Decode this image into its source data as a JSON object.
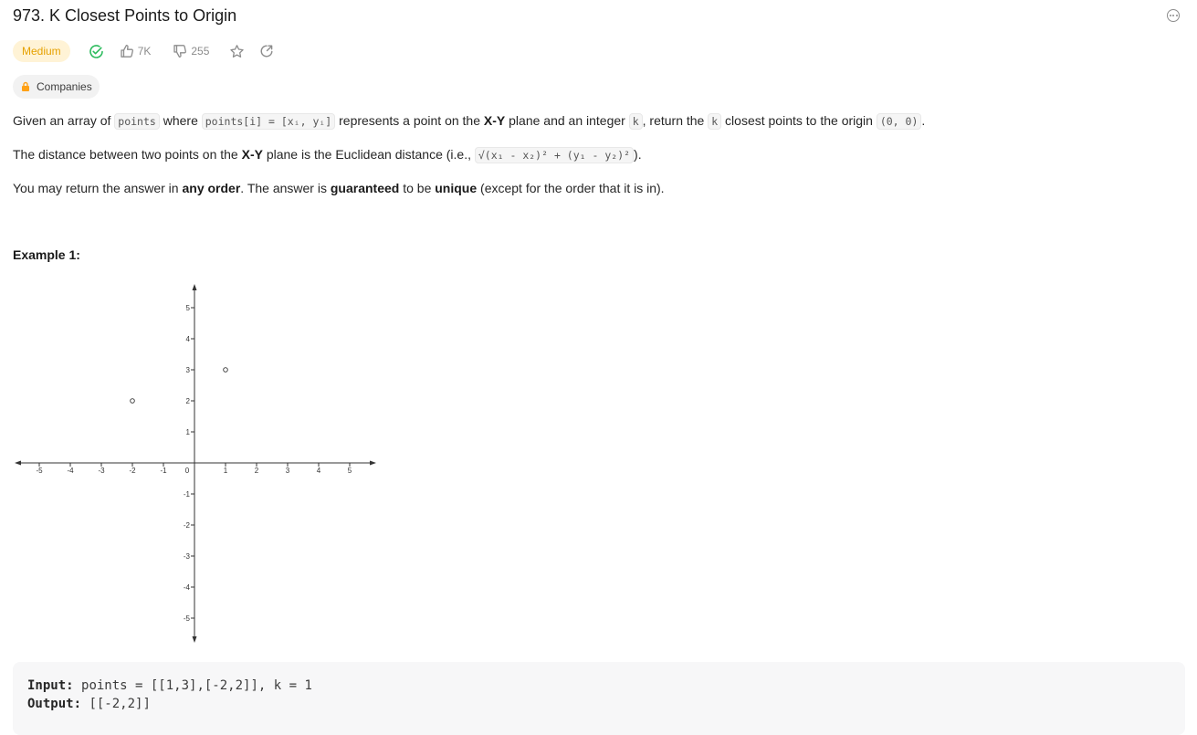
{
  "problem": {
    "title": "973. K Closest Points to Origin",
    "difficulty": "Medium",
    "likes": "7K",
    "dislikes": "255",
    "companies_label": "Companies"
  },
  "description": {
    "p1": {
      "t1": "Given an array of ",
      "c1": "points",
      "t2": " where ",
      "c2": "points[i] = [xᵢ, yᵢ]",
      "t3": " represents a point on the ",
      "b1": "X-Y",
      "t4": " plane and an integer ",
      "c3": "k",
      "t5": ", return the ",
      "c4": "k",
      "t6": " closest points to the origin ",
      "c5": "(0, 0)",
      "t7": "."
    },
    "p2": {
      "t1": "The distance between two points on the ",
      "b1": "X-Y",
      "t2": " plane is the Euclidean distance (i.e., ",
      "c1": "√(x₁ - x₂)² + (y₁ - y₂)²",
      "t3": ")."
    },
    "p3": {
      "t1": "You may return the answer in ",
      "b1": "any order",
      "t2": ". The answer is ",
      "b2": "guaranteed",
      "t3": " to be ",
      "b3": "unique",
      "t4": " (except for the order that it is in)."
    }
  },
  "example": {
    "heading": "Example 1:",
    "input_label": "Input:",
    "input_value": "points = [[1,3],[-2,2]], k = 1",
    "output_label": "Output:",
    "output_value": "[[-2,2]]"
  },
  "chart_data": {
    "type": "scatter",
    "x_ticks": [
      "-5",
      "-4",
      "-3",
      "-2",
      "-1",
      "0",
      "1",
      "2",
      "3",
      "4",
      "5"
    ],
    "y_ticks": [
      "5",
      "4",
      "3",
      "2",
      "1",
      "-1",
      "-2",
      "-3",
      "-4",
      "-5"
    ],
    "xlim": [
      -5,
      5
    ],
    "ylim": [
      -5,
      5
    ],
    "points": [
      {
        "x": 1,
        "y": 3
      },
      {
        "x": -2,
        "y": 2
      }
    ],
    "marker": "open-circle",
    "grid": false
  }
}
